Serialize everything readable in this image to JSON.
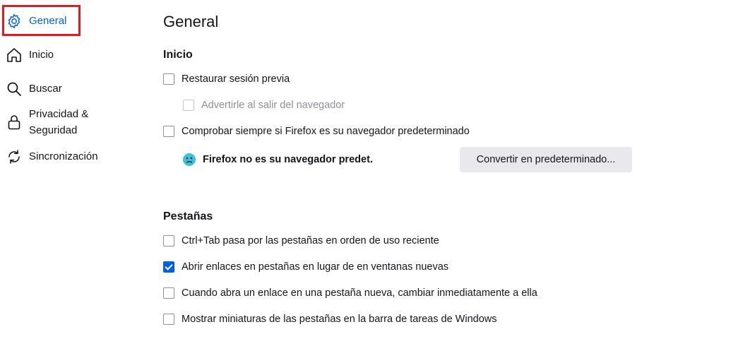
{
  "sidebar": {
    "items": [
      {
        "label": "General",
        "icon": "gear-icon",
        "selected": true
      },
      {
        "label": "Inicio",
        "icon": "home-icon"
      },
      {
        "label": "Buscar",
        "icon": "search-icon"
      },
      {
        "label": "Privacidad &",
        "label2": "Seguridad",
        "icon": "lock-icon"
      },
      {
        "label": "Sincronización",
        "icon": "sync-icon"
      }
    ]
  },
  "main": {
    "title": "General",
    "startup": {
      "heading": "Inicio",
      "restore_session": "Restaurar sesión previa",
      "warn_on_quit": "Advertirle al salir del navegador",
      "check_default": "Comprobar siempre si Firefox es su navegador predeterminado",
      "status_text": "Firefox no es su navegador predet.",
      "make_default_button": "Convertir en predeterminado..."
    },
    "tabs": {
      "heading": "Pestañas",
      "ctrl_tab": "Ctrl+Tab pasa por las pestañas en orden de uso reciente",
      "open_links_in_tabs": "Abrir enlaces en pestañas en lugar de en ventanas nuevas",
      "switch_to_new_tab": "Cuando abra un enlace en una pestaña nueva, cambiar inmediatamente a ella",
      "taskbar_previews": "Mostrar miniaturas de las pestañas en la barra de tareas de Windows"
    }
  },
  "colors": {
    "accent": "#0061e0",
    "highlight": "#e01b24",
    "button_bg": "#e9e9ed"
  }
}
